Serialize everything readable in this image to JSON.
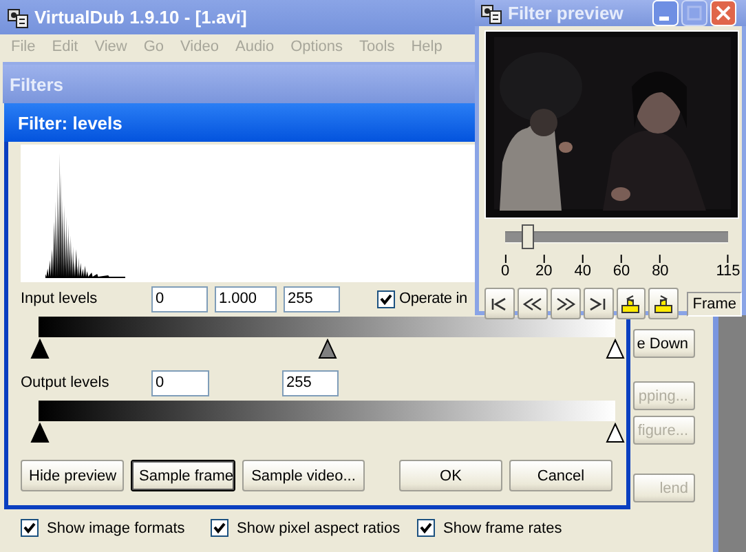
{
  "main_window": {
    "title": "VirtualDub 1.9.10 - [1.avi]",
    "menu": [
      {
        "label": "File",
        "disabled": true
      },
      {
        "label": "Edit",
        "disabled": true
      },
      {
        "label": "View",
        "disabled": true
      },
      {
        "label": "Go",
        "disabled": true
      },
      {
        "label": "Video",
        "disabled": true
      },
      {
        "label": "Audio",
        "disabled": true
      },
      {
        "label": "Options",
        "disabled": true
      },
      {
        "label": "Tools",
        "disabled": true
      },
      {
        "label": "Help",
        "disabled": true
      }
    ]
  },
  "filters_dialog": {
    "title": "Filters",
    "side_buttons": [
      {
        "label": "e Down",
        "disabled": false
      },
      {
        "label": "pping...",
        "disabled": true
      },
      {
        "label": "figure...",
        "disabled": true
      },
      {
        "label": "lend",
        "disabled": true
      }
    ],
    "checkboxes": [
      {
        "label": "Show image formats",
        "checked": true
      },
      {
        "label": "Show pixel aspect ratios",
        "checked": true
      },
      {
        "label": "Show frame rates",
        "checked": true
      }
    ]
  },
  "levels_dialog": {
    "title": "Filter: levels",
    "input_label": "Input levels",
    "input_values": [
      "0",
      "1.000",
      "255"
    ],
    "operate": {
      "label": "Operate in",
      "checked": true
    },
    "input_markers": [
      {
        "kind": "black",
        "level": 0
      },
      {
        "kind": "grey",
        "level": 0.5
      },
      {
        "kind": "white",
        "level": 1
      }
    ],
    "output_label": "Output levels",
    "output_values": [
      "0",
      "255"
    ],
    "output_markers": [
      {
        "kind": "black",
        "level": 0
      },
      {
        "kind": "white",
        "level": 1
      }
    ],
    "buttons": [
      {
        "label": "Hide preview",
        "default": false
      },
      {
        "label": "Sample frame",
        "default": true
      },
      {
        "label": "Sample video...",
        "default": false
      },
      {
        "label": "OK",
        "default": false
      },
      {
        "label": "Cancel",
        "default": false
      }
    ]
  },
  "preview_window": {
    "title": "Filter preview",
    "slider": {
      "level": 0.1
    },
    "ticks": [
      "0",
      "20",
      "40",
      "60",
      "80",
      "115"
    ],
    "nav_buttons": [
      {
        "kind": "start"
      },
      {
        "kind": "back"
      },
      {
        "kind": "forward"
      },
      {
        "kind": "end"
      },
      {
        "kind": "mark-in"
      },
      {
        "kind": "mark-out"
      }
    ],
    "frame_label": "Frame"
  }
}
